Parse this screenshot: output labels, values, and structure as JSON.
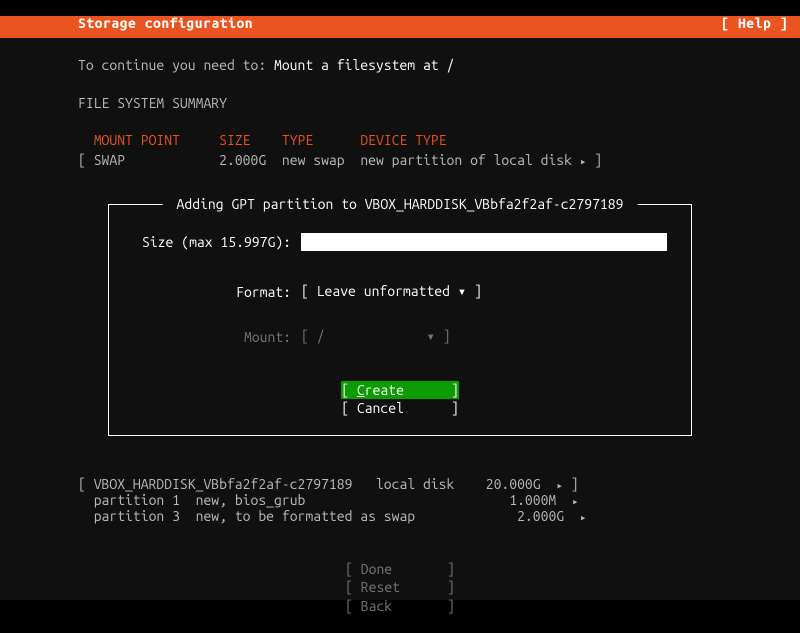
{
  "header": {
    "title": "Storage configuration",
    "help": "[ Help ]"
  },
  "intro": {
    "prefix": "To continue you need to: ",
    "action": "Mount a filesystem at /"
  },
  "summary": {
    "heading": "FILE SYSTEM SUMMARY",
    "cols": {
      "c1": "MOUNT POINT",
      "c2": "SIZE",
      "c3": "TYPE",
      "c4": "DEVICE TYPE"
    },
    "row": {
      "mount": "SWAP",
      "size": "2.000G",
      "type": "new swap",
      "dev": "new partition of local disk",
      "arrow": "▸"
    }
  },
  "dialog": {
    "title_prefix": " Adding GPT partition to ",
    "title_disk": "VBOX_HARDDISK_VBbfa2f2af-c2797189",
    "size_label": "Size (max 15.997G):",
    "format_label": "Format:",
    "format_value": "Leave unformatted",
    "mount_label": "Mount:",
    "mount_value": "/",
    "create": "Create",
    "cancel": "Cancel"
  },
  "disks": {
    "row1": {
      "lb": "[ ",
      "name": "VBOX_HARDDISK_VBbfa2f2af-c2797189",
      "kind": "local disk",
      "size": "20.000G",
      "arrow": "▸",
      "rb": "]"
    },
    "row2": {
      "name": "partition 1",
      "desc": "new, bios_grub",
      "size": "1.000M",
      "arrow": "▸"
    },
    "row3": {
      "name": "partition 3",
      "desc": "new, to be formatted as swap",
      "size": "2.000G",
      "arrow": "▸"
    }
  },
  "nav": {
    "done": "Done",
    "reset": "Reset",
    "back": "Back"
  }
}
